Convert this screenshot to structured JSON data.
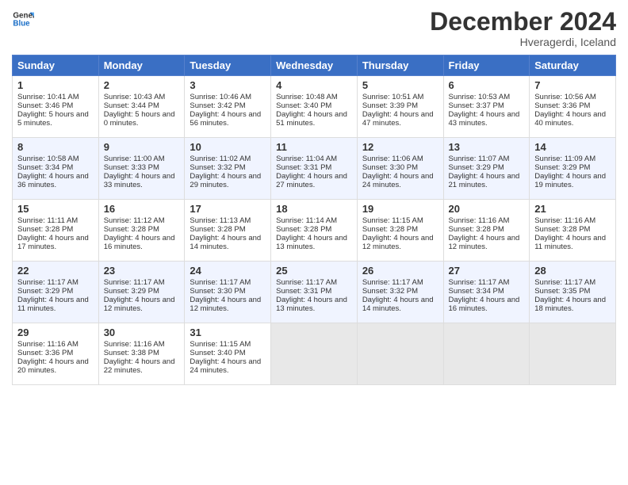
{
  "logo": {
    "line1": "General",
    "line2": "Blue"
  },
  "header": {
    "month": "December 2024",
    "location": "Hveragerdi, Iceland"
  },
  "days_of_week": [
    "Sunday",
    "Monday",
    "Tuesday",
    "Wednesday",
    "Thursday",
    "Friday",
    "Saturday"
  ],
  "weeks": [
    [
      {
        "day": "1",
        "sunrise": "10:41 AM",
        "sunset": "3:46 PM",
        "daylight": "5 hours and 5 minutes."
      },
      {
        "day": "2",
        "sunrise": "10:43 AM",
        "sunset": "3:44 PM",
        "daylight": "5 hours and 0 minutes."
      },
      {
        "day": "3",
        "sunrise": "10:46 AM",
        "sunset": "3:42 PM",
        "daylight": "4 hours and 56 minutes."
      },
      {
        "day": "4",
        "sunrise": "10:48 AM",
        "sunset": "3:40 PM",
        "daylight": "4 hours and 51 minutes."
      },
      {
        "day": "5",
        "sunrise": "10:51 AM",
        "sunset": "3:39 PM",
        "daylight": "4 hours and 47 minutes."
      },
      {
        "day": "6",
        "sunrise": "10:53 AM",
        "sunset": "3:37 PM",
        "daylight": "4 hours and 43 minutes."
      },
      {
        "day": "7",
        "sunrise": "10:56 AM",
        "sunset": "3:36 PM",
        "daylight": "4 hours and 40 minutes."
      }
    ],
    [
      {
        "day": "8",
        "sunrise": "10:58 AM",
        "sunset": "3:34 PM",
        "daylight": "4 hours and 36 minutes."
      },
      {
        "day": "9",
        "sunrise": "11:00 AM",
        "sunset": "3:33 PM",
        "daylight": "4 hours and 33 minutes."
      },
      {
        "day": "10",
        "sunrise": "11:02 AM",
        "sunset": "3:32 PM",
        "daylight": "4 hours and 29 minutes."
      },
      {
        "day": "11",
        "sunrise": "11:04 AM",
        "sunset": "3:31 PM",
        "daylight": "4 hours and 27 minutes."
      },
      {
        "day": "12",
        "sunrise": "11:06 AM",
        "sunset": "3:30 PM",
        "daylight": "4 hours and 24 minutes."
      },
      {
        "day": "13",
        "sunrise": "11:07 AM",
        "sunset": "3:29 PM",
        "daylight": "4 hours and 21 minutes."
      },
      {
        "day": "14",
        "sunrise": "11:09 AM",
        "sunset": "3:29 PM",
        "daylight": "4 hours and 19 minutes."
      }
    ],
    [
      {
        "day": "15",
        "sunrise": "11:11 AM",
        "sunset": "3:28 PM",
        "daylight": "4 hours and 17 minutes."
      },
      {
        "day": "16",
        "sunrise": "11:12 AM",
        "sunset": "3:28 PM",
        "daylight": "4 hours and 16 minutes."
      },
      {
        "day": "17",
        "sunrise": "11:13 AM",
        "sunset": "3:28 PM",
        "daylight": "4 hours and 14 minutes."
      },
      {
        "day": "18",
        "sunrise": "11:14 AM",
        "sunset": "3:28 PM",
        "daylight": "4 hours and 13 minutes."
      },
      {
        "day": "19",
        "sunrise": "11:15 AM",
        "sunset": "3:28 PM",
        "daylight": "4 hours and 12 minutes."
      },
      {
        "day": "20",
        "sunrise": "11:16 AM",
        "sunset": "3:28 PM",
        "daylight": "4 hours and 12 minutes."
      },
      {
        "day": "21",
        "sunrise": "11:16 AM",
        "sunset": "3:28 PM",
        "daylight": "4 hours and 11 minutes."
      }
    ],
    [
      {
        "day": "22",
        "sunrise": "11:17 AM",
        "sunset": "3:29 PM",
        "daylight": "4 hours and 11 minutes."
      },
      {
        "day": "23",
        "sunrise": "11:17 AM",
        "sunset": "3:29 PM",
        "daylight": "4 hours and 12 minutes."
      },
      {
        "day": "24",
        "sunrise": "11:17 AM",
        "sunset": "3:30 PM",
        "daylight": "4 hours and 12 minutes."
      },
      {
        "day": "25",
        "sunrise": "11:17 AM",
        "sunset": "3:31 PM",
        "daylight": "4 hours and 13 minutes."
      },
      {
        "day": "26",
        "sunrise": "11:17 AM",
        "sunset": "3:32 PM",
        "daylight": "4 hours and 14 minutes."
      },
      {
        "day": "27",
        "sunrise": "11:17 AM",
        "sunset": "3:34 PM",
        "daylight": "4 hours and 16 minutes."
      },
      {
        "day": "28",
        "sunrise": "11:17 AM",
        "sunset": "3:35 PM",
        "daylight": "4 hours and 18 minutes."
      }
    ],
    [
      {
        "day": "29",
        "sunrise": "11:16 AM",
        "sunset": "3:36 PM",
        "daylight": "4 hours and 20 minutes."
      },
      {
        "day": "30",
        "sunrise": "11:16 AM",
        "sunset": "3:38 PM",
        "daylight": "4 hours and 22 minutes."
      },
      {
        "day": "31",
        "sunrise": "11:15 AM",
        "sunset": "3:40 PM",
        "daylight": "4 hours and 24 minutes."
      },
      null,
      null,
      null,
      null
    ]
  ]
}
